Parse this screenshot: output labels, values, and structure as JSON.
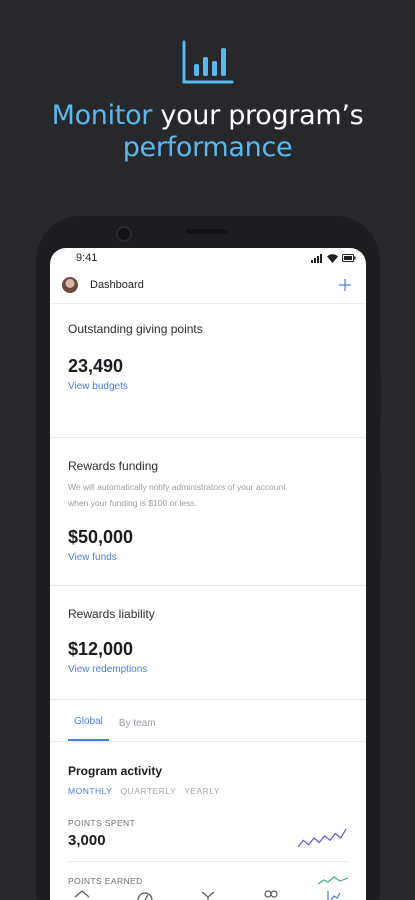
{
  "headline": {
    "highlight1": "Monitor",
    "normal": " your program’s",
    "highlight2": "performance"
  },
  "status_bar": {
    "time": "9:41"
  },
  "topbar": {
    "title": "Dashboard"
  },
  "cards": [
    {
      "label": "Outstanding giving points",
      "value": "23,490",
      "link": "View budgets"
    },
    {
      "label": "Rewards funding",
      "description": "We will automatically notify administrators of your account when your funding is $100 or less.",
      "value": "$50,000",
      "link": "View funds"
    },
    {
      "label": "Rewards liability",
      "value": "$12,000",
      "link": "View redemptions"
    }
  ],
  "tabs": [
    {
      "label": "Global",
      "active": true
    },
    {
      "label": "By team",
      "active": false
    }
  ],
  "activity": {
    "heading": "Program activity",
    "periods": [
      {
        "label": "MONTHLY",
        "active": true
      },
      {
        "label": "QUARTERLY",
        "active": false
      },
      {
        "label": "YEARLY",
        "active": false
      }
    ],
    "points_spent": {
      "label": "POINTS SPENT",
      "value": "3,000",
      "trend": [
        4,
        7,
        5,
        8,
        6,
        9,
        7,
        10,
        8,
        12
      ]
    },
    "points_earned": {
      "label": "POINTS EARNED"
    }
  },
  "bottom_nav": [
    "home-icon",
    "gauge-icon",
    "gift-icon",
    "people-icon",
    "chart-icon"
  ],
  "colors": {
    "background": "#27282c",
    "accent": "#5bb8ee",
    "link": "#4a7de0"
  }
}
